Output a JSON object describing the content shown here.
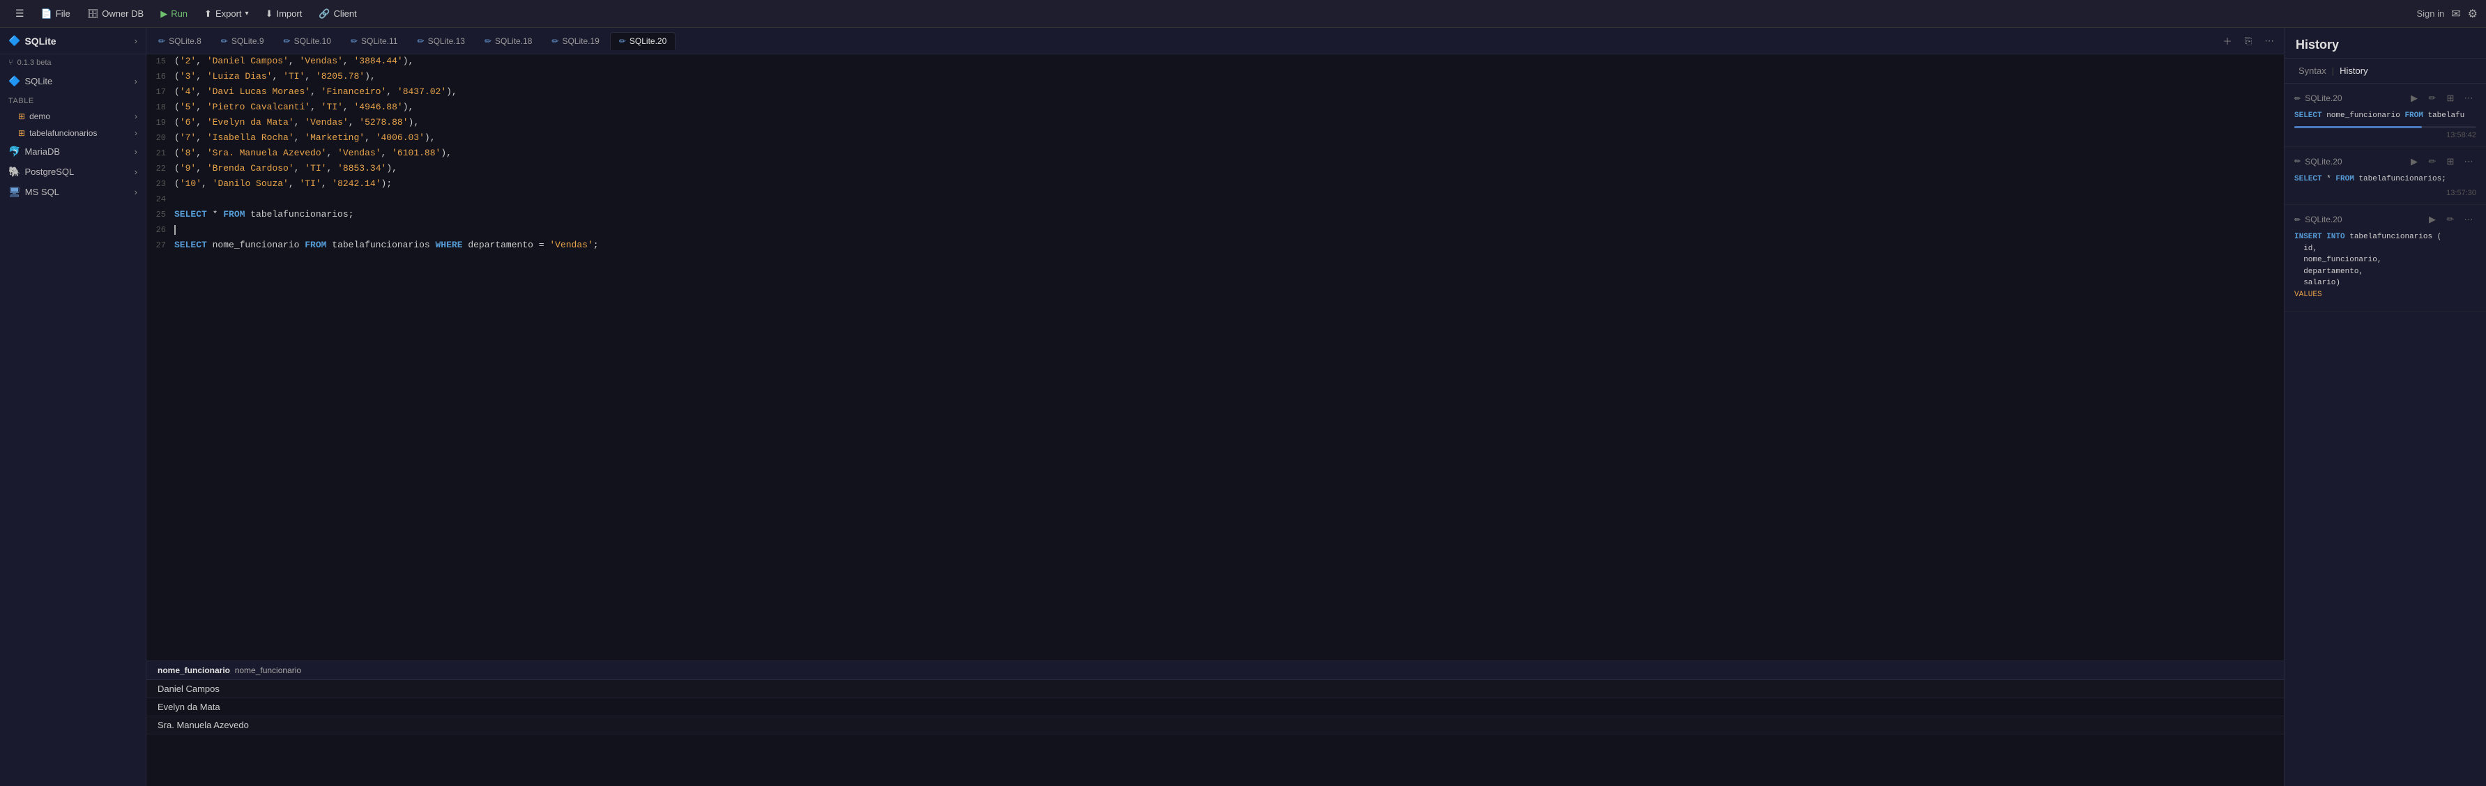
{
  "topbar": {
    "menu_icon": "☰",
    "file_label": "File",
    "owner_db_label": "Owner DB",
    "run_label": "Run",
    "export_label": "Export",
    "import_label": "Import",
    "client_label": "Client",
    "sign_in_label": "Sign in"
  },
  "sidebar": {
    "brand": "SQLite",
    "version": "0.1.3 beta",
    "section_label": "Table",
    "databases": [
      {
        "name": "SQLite",
        "type": "db"
      },
      {
        "name": "demo",
        "type": "table"
      },
      {
        "name": "tabelafuncionarios",
        "type": "table"
      },
      {
        "name": "MariaDB",
        "type": "db"
      },
      {
        "name": "PostgreSQL",
        "type": "db"
      },
      {
        "name": "MS SQL",
        "type": "db"
      }
    ]
  },
  "tabs": [
    {
      "label": "SQLite.8"
    },
    {
      "label": "SQLite.9"
    },
    {
      "label": "SQLite.10"
    },
    {
      "label": "SQLite.11"
    },
    {
      "label": "SQLite.13"
    },
    {
      "label": "SQLite.18"
    },
    {
      "label": "SQLite.19"
    },
    {
      "label": "SQLite.20",
      "active": true
    }
  ],
  "editor": {
    "lines": [
      {
        "num": 15,
        "content": "('2', 'Daniel Campos', 'Vendas', '3884.44'),"
      },
      {
        "num": 16,
        "content": "('3', 'Luiza Dias', 'TI', '8205.78'),"
      },
      {
        "num": 17,
        "content": "('4', 'Davi Lucas Moraes', 'Financeiro', '8437.02'),"
      },
      {
        "num": 18,
        "content": "('5', 'Pietro Cavalcanti', 'TI', '4946.88'),"
      },
      {
        "num": 19,
        "content": "('6', 'Evelyn da Mata', 'Vendas', '5278.88'),"
      },
      {
        "num": 20,
        "content": "('7', 'Isabella Rocha', 'Marketing', '4006.03'),"
      },
      {
        "num": 21,
        "content": "('8', 'Sra. Manuela Azevedo', 'Vendas', '6101.88'),"
      },
      {
        "num": 22,
        "content": "('9', 'Brenda Cardoso', 'TI', '8853.34'),"
      },
      {
        "num": 23,
        "content": "('10', 'Danilo Souza', 'TI', '8242.14');"
      },
      {
        "num": 24,
        "content": ""
      },
      {
        "num": 25,
        "content": "SELECT * FROM tabelafuncionarios;",
        "highlight_select": true
      },
      {
        "num": 26,
        "content": ""
      },
      {
        "num": 27,
        "content": "SELECT nome_funcionario FROM tabelafuncionarios WHERE departamento = 'Vendas';"
      }
    ]
  },
  "results": {
    "column": "nome_funcionario",
    "rows": [
      "Daniel Campos",
      "Evelyn da Mata",
      "Sra. Manuela Azevedo"
    ]
  },
  "history": {
    "title": "History",
    "tabs": [
      "Syntax",
      "History"
    ],
    "items": [
      {
        "db": "SQLite.20",
        "sql": "SELECT nome_funcionario FROM tabelafu",
        "time": "13:58:42",
        "progress": 70
      },
      {
        "db": "SQLite.20",
        "sql": "SELECT * FROM tabelafuncionarios;",
        "time": "13:57:30",
        "progress": 0
      },
      {
        "db": "SQLite.20",
        "sql": "INSERT INTO tabelafuncionarios (\n  id,\n  nome_funcionario,\n  departamento,\n  salario)\nVALUES",
        "time": "",
        "progress": 0,
        "has_values": true
      }
    ]
  }
}
